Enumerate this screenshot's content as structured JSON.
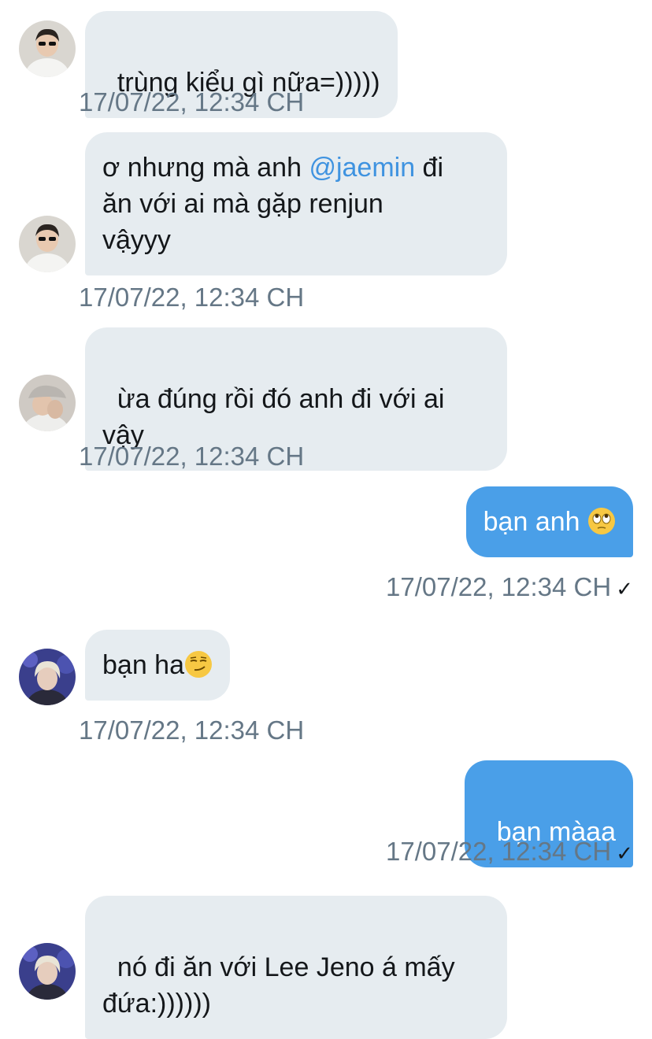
{
  "messages": [
    {
      "direction": "in",
      "avatar": "avatar-sunglasses-person",
      "text": "trùng kiểu gì nữa=)))))",
      "timestamp": "17/07/22, 12:34 CH"
    },
    {
      "direction": "in",
      "avatar": "avatar-sunglasses-person",
      "text_before": "ơ nhưng mà anh ",
      "mention": "@jaemin",
      "text_after": " đi\năn với ai mà gặp renjun\nvậyyy",
      "timestamp": "17/07/22, 12:34 CH"
    },
    {
      "direction": "in",
      "avatar": "avatar-cap-person",
      "text": "ừa đúng rồi đó anh đi với ai\nvậy",
      "timestamp": "17/07/22, 12:34 CH"
    },
    {
      "direction": "out",
      "text": "bạn anh ",
      "emoji": "eye-roll-emoji",
      "timestamp": "17/07/22, 12:34 CH",
      "status": "✓"
    },
    {
      "direction": "in",
      "avatar": "avatar-blond-person",
      "text": "bạn ha",
      "emoji": "smirk-emoji",
      "timestamp": "17/07/22, 12:34 CH"
    },
    {
      "direction": "out",
      "text": "bạn màaa",
      "timestamp": "17/07/22, 12:34 CH",
      "status": "✓"
    },
    {
      "direction": "in",
      "avatar": "avatar-blond-person",
      "text": "nó đi ăn với Lee Jeno á mấy\nđứa:))))))"
    }
  ],
  "colors": {
    "incoming_bubble": "#e6ecf0",
    "outgoing_bubble": "#4a9fe8",
    "mention": "#3f93e0",
    "timestamp": "#657786"
  }
}
